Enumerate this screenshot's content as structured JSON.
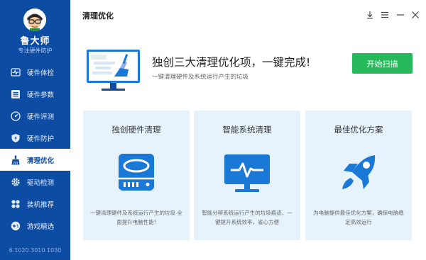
{
  "app": {
    "brand": "鲁大师",
    "slogan": "专注硬件防护",
    "version": "6.1020.3010.1030"
  },
  "sidebar": {
    "items": [
      {
        "label": "硬件体检",
        "icon": "heartbeat-icon",
        "active": false
      },
      {
        "label": "硬件参数",
        "icon": "list-icon",
        "active": false
      },
      {
        "label": "硬件评测",
        "icon": "speedometer-icon",
        "active": false
      },
      {
        "label": "硬件防护",
        "icon": "shield-icon",
        "active": false
      },
      {
        "label": "清理优化",
        "icon": "broom-icon",
        "active": true
      },
      {
        "label": "驱动检测",
        "icon": "gear-icon",
        "active": false
      },
      {
        "label": "装机推荐",
        "icon": "fan-icon",
        "active": false
      },
      {
        "label": "游戏精选",
        "icon": "gamepad-icon",
        "active": false
      }
    ]
  },
  "header": {
    "title": "清理优化",
    "window_controls": [
      "download-icon",
      "menu-icon",
      "minimize-icon",
      "close-icon"
    ]
  },
  "hero": {
    "heading": "独创三大清理优化项，一键完成!",
    "subtitle": "一键清理硬件及系统运行产生的垃圾",
    "scan_button": "开始扫描"
  },
  "cards": [
    {
      "title": "独创硬件清理",
      "desc": "一键清理硬件及系统运行产生的垃圾 全面提升电脑性能!",
      "icon": "hard-drive-icon"
    },
    {
      "title": "智能系统清理",
      "desc": "智能分辨系统运行产生的垃圾痕迹、一键提升系统效率，省心方便",
      "icon": "monitor-pulse-icon"
    },
    {
      "title": "最佳优化方案",
      "desc": "为电脑提供最佳优化方案，确保电脑稳定高效运行",
      "icon": "rocket-icon"
    }
  ],
  "colors": {
    "sidebar_bg": "#0d4ca3",
    "accent_blue": "#1a78d6",
    "scan_green": "#27b85c",
    "card_bg": "#e6f3fd"
  }
}
